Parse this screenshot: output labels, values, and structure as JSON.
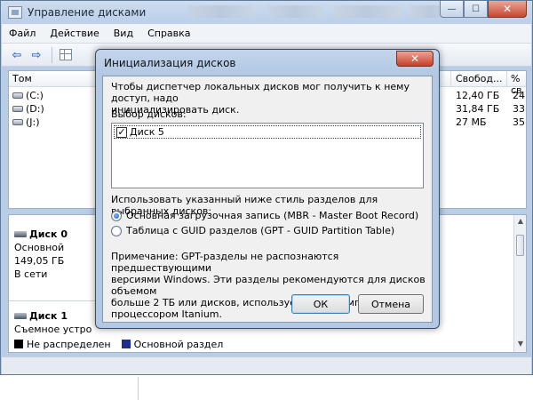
{
  "window": {
    "title": "Управление дисками",
    "min_glyph": "—",
    "max_glyph": "☐",
    "close_glyph": "✕"
  },
  "menu": [
    "Файл",
    "Действие",
    "Вид",
    "Справка"
  ],
  "toolbar": {
    "icons": [
      "back-arrow-icon",
      "forward-arrow-icon",
      "grid-view-icon"
    ],
    "back_glyph": "⇦",
    "forward_glyph": "⇨"
  },
  "volume_list": {
    "columns": {
      "volume": "Том",
      "free": "Свобод...",
      "percent": "% св"
    },
    "rows": [
      {
        "name": "(C:)",
        "free": "12,40 ГБ",
        "percent": "24"
      },
      {
        "name": "(D:)",
        "free": "31,84 ГБ",
        "percent": "33"
      },
      {
        "name": "(J:)",
        "free": "27 МБ",
        "percent": "35"
      }
    ]
  },
  "disks": [
    {
      "name": "Диск 0",
      "lines": [
        "Основной",
        "149,05 ГБ",
        "В сети"
      ]
    },
    {
      "name": "Диск 1",
      "lines": [
        "Съемное устро"
      ]
    }
  ],
  "legend": [
    {
      "label": "Не распределен",
      "color": "#000000"
    },
    {
      "label": "Основной раздел",
      "color": "#1f2f8f"
    }
  ],
  "dialog": {
    "title": "Инициализация дисков",
    "close_glyph": "✕",
    "intro_line1": "Чтобы диспетчер локальных дисков мог получить к нему доступ, надо",
    "intro_line2": "инициализировать диск.",
    "select_label": "Выбор дисков:",
    "disk_items": [
      {
        "label": "Диск 5",
        "checked": true,
        "check_glyph": "✓"
      }
    ],
    "style_label": "Использовать указанный ниже стиль разделов для выбранных дисков:",
    "options": [
      {
        "label": "Основная загрузочная запись (MBR - Master Boot Record)",
        "selected": true
      },
      {
        "label": "Таблица с GUID разделов (GPT - GUID Partition Table)",
        "selected": false
      }
    ],
    "note_lines": [
      "Примечание: GPT-разделы не распознаются предшествующими",
      "версиями Windows. Эти разделы рекомендуются для дисков объемом",
      "больше 2 ТБ или дисков, используемых на компьютерах с",
      "процессором Itanium."
    ],
    "ok_label": "ОК",
    "cancel_label": "Отмена"
  }
}
